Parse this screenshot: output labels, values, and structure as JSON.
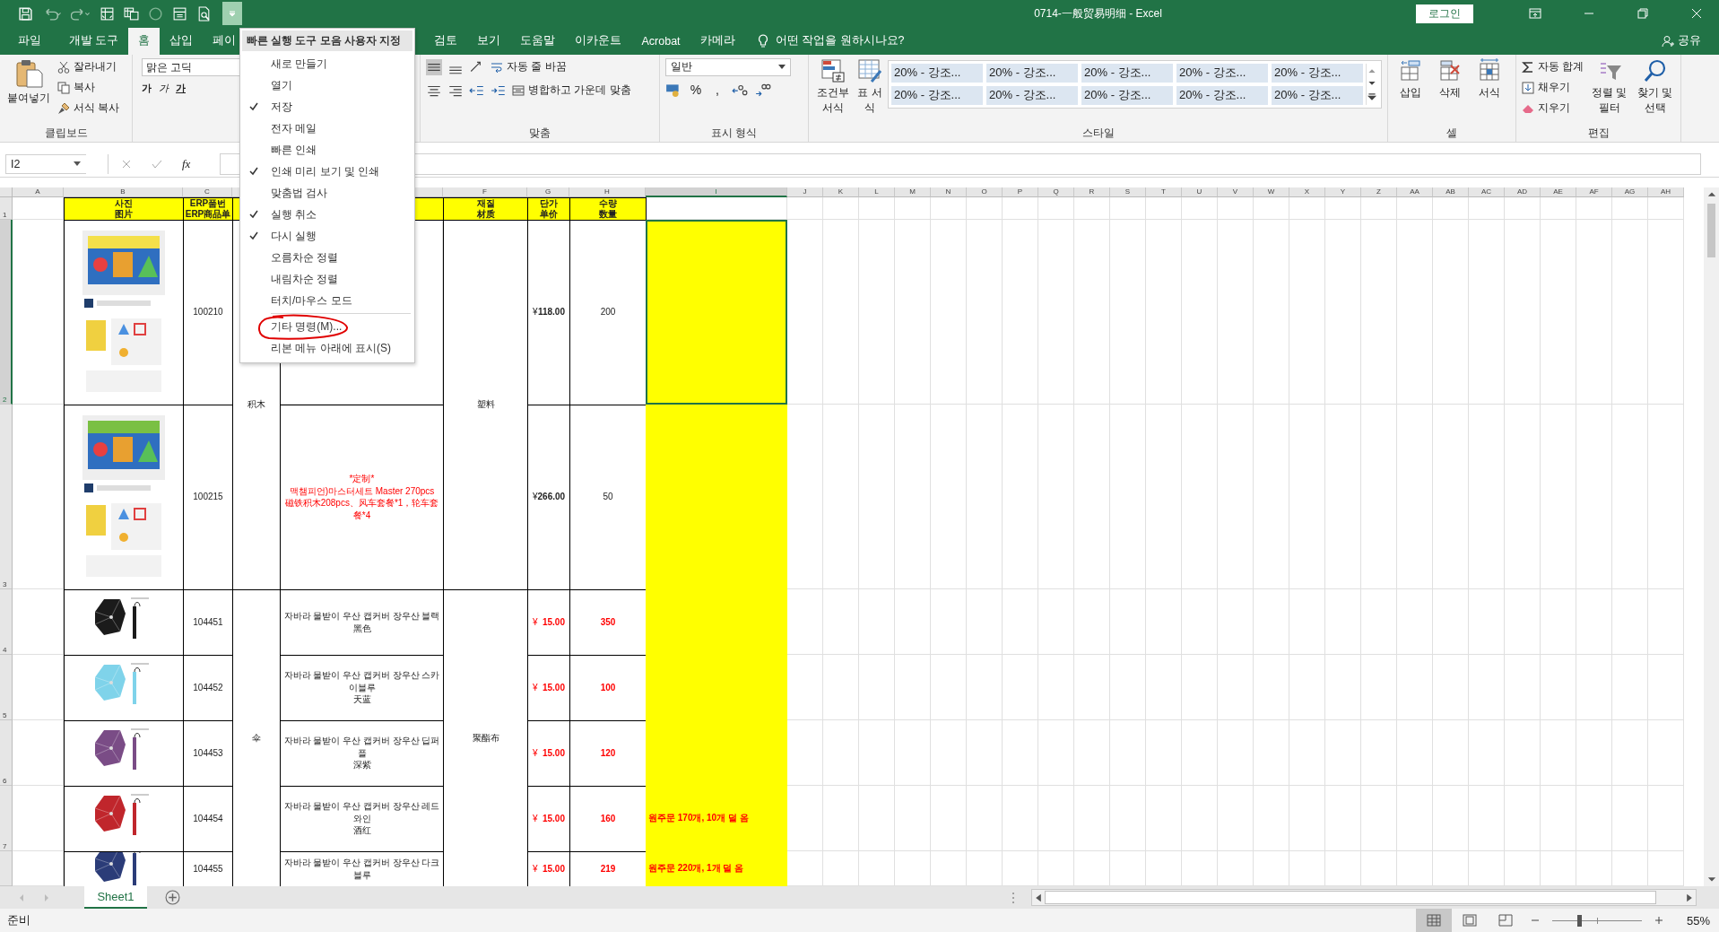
{
  "title_bar": {
    "file_title": "0714-一般贸易明细  -  Excel",
    "login": "로그인"
  },
  "tabs": [
    {
      "label": "파일",
      "selected": false
    },
    {
      "label": "개발 도구",
      "selected": false
    },
    {
      "label": "홈",
      "selected": true
    },
    {
      "label": "삽입",
      "selected": false
    },
    {
      "label": "페이",
      "selected": false
    },
    {
      "label": "검토",
      "selected": false
    },
    {
      "label": "보기",
      "selected": false
    },
    {
      "label": "도움말",
      "selected": false
    },
    {
      "label": "이카운트",
      "selected": false
    },
    {
      "label": "Acrobat",
      "selected": false
    },
    {
      "label": "카메라",
      "selected": false
    }
  ],
  "tell_me": "어떤 작업을 원하시나요?",
  "share": "공유",
  "ribbon": {
    "clipboard": {
      "label": "클립보드",
      "paste": "붙여넣기",
      "cut": "잘라내기",
      "copy": "복사",
      "format_painter": "서식 복사"
    },
    "font": {
      "font_name": "맑은 고딕",
      "buttons": [
        {
          "label": "가",
          "kind": "bold"
        },
        {
          "label": "가",
          "kind": "italic"
        },
        {
          "label": "가",
          "kind": "underline"
        }
      ]
    },
    "alignment": {
      "label": "맞춤",
      "wrap_text": "자동 줄 바꿈",
      "merge_center": "병합하고 가운데 맞춤"
    },
    "number": {
      "label": "표시 형식",
      "format": "일반",
      "percent": "%",
      "comma": ","
    },
    "styles": {
      "label": "스타일",
      "conditional": "조건부 서식",
      "table": "표 서식",
      "cell_styles": [
        "20% - 강조...",
        "20% - 강조...",
        "20% - 강조...",
        "20% - 강조...",
        "20% - 강조...",
        "20% - 강조...",
        "20% - 강조...",
        "20% - 강조...",
        "20% - 강조...",
        "20% - 강조..."
      ]
    },
    "cells": {
      "label": "셀",
      "buttons": [
        {
          "label": "삽입",
          "kind": "insert"
        },
        {
          "label": "삭제",
          "kind": "delete"
        },
        {
          "label": "서식",
          "kind": "format"
        }
      ]
    },
    "editing": {
      "label": "편집",
      "autosum": "자동 합계",
      "fill": "채우기",
      "clear": "지우기",
      "sort_filter": "정렬 및 필터",
      "find_select": "찾기 및 선택"
    }
  },
  "quick_access_menu": {
    "title": "빠른 실행 도구 모음 사용자 지정",
    "items": [
      {
        "label": "새로 만들기",
        "kind": "option",
        "checked": false,
        "circled": false
      },
      {
        "label": "열기",
        "kind": "option",
        "checked": false,
        "circled": false
      },
      {
        "label": "저장",
        "kind": "option",
        "checked": true,
        "circled": false
      },
      {
        "label": "전자 메일",
        "kind": "option",
        "checked": false,
        "circled": false
      },
      {
        "label": "빠른 인쇄",
        "kind": "option",
        "checked": false,
        "circled": false
      },
      {
        "label": "인쇄 미리 보기 및 인쇄",
        "kind": "option",
        "checked": true,
        "circled": false
      },
      {
        "label": "맞춤법 검사",
        "kind": "option",
        "checked": false,
        "circled": false
      },
      {
        "label": "실행 취소",
        "kind": "option",
        "checked": true,
        "circled": false
      },
      {
        "label": "다시 실행",
        "kind": "option",
        "checked": true,
        "circled": false
      },
      {
        "label": "오름차순 정렬",
        "kind": "option",
        "checked": false,
        "circled": false
      },
      {
        "label": "내림차순 정렬",
        "kind": "option",
        "checked": false,
        "circled": false
      },
      {
        "label": "터치/마우스 모드",
        "kind": "option",
        "checked": false,
        "circled": false
      },
      {
        "label": "기타 명령(M)...",
        "kind": "command",
        "circled": true
      },
      {
        "label": "리본 메뉴 아래에 표시(S)",
        "kind": "command",
        "circled": false
      }
    ]
  },
  "formula_bar": {
    "name_box": "I2",
    "function_label": "fx"
  },
  "sheet": {
    "columns": [
      {
        "label": "A",
        "selected": false
      },
      {
        "label": "B",
        "selected": false
      },
      {
        "label": "C",
        "selected": false
      },
      {
        "selected": false
      },
      {
        "selected": false
      },
      {
        "label": "F",
        "selected": false
      },
      {
        "label": "G",
        "selected": false
      },
      {
        "label": "H",
        "selected": false
      },
      {
        "label": "I",
        "selected": true
      },
      {
        "label": "J",
        "selected": false
      },
      {
        "label": "K",
        "selected": false
      },
      {
        "label": "L",
        "selected": false
      },
      {
        "label": "M",
        "selected": false
      },
      {
        "label": "N",
        "selected": false
      },
      {
        "label": "O",
        "selected": false
      },
      {
        "label": "P",
        "selected": false
      },
      {
        "label": "Q",
        "selected": false
      },
      {
        "label": "R",
        "selected": false
      },
      {
        "label": "S",
        "selected": false
      },
      {
        "label": "T",
        "selected": false
      },
      {
        "label": "U",
        "selected": false
      },
      {
        "label": "V",
        "selected": false
      },
      {
        "label": "W",
        "selected": false
      },
      {
        "label": "X",
        "selected": false
      },
      {
        "label": "Y",
        "selected": false
      },
      {
        "label": "Z",
        "selected": false
      },
      {
        "label": "AA",
        "selected": false
      },
      {
        "label": "AB",
        "selected": false
      },
      {
        "label": "AC",
        "selected": false
      },
      {
        "label": "AD",
        "selected": false
      },
      {
        "label": "AE",
        "selected": false
      },
      {
        "label": "AF",
        "selected": false
      },
      {
        "label": "AG",
        "selected": false
      },
      {
        "label": "AH",
        "selected": false
      }
    ],
    "rows": [
      {
        "number": "1",
        "selected": false,
        "cells": [
          null,
          {
            "kind": "header",
            "lines": [
              "사진",
              "图片"
            ]
          },
          {
            "kind": "header",
            "lines": [
              "ERP품번",
              "ERP商品单"
            ]
          },
          {
            "kind": "header"
          },
          {
            "kind": "header"
          },
          {
            "kind": "header",
            "lines": [
              "재질",
              "材质"
            ]
          },
          {
            "kind": "header",
            "lines": [
              "단가",
              "单价"
            ]
          },
          {
            "kind": "header",
            "lines": [
              "수량",
              "数量"
            ]
          },
          null
        ]
      },
      {
        "number": "2",
        "selected": true,
        "cells": [
          null,
          {
            "kind": "picture"
          },
          {
            "kind": "text",
            "lines": [
              "100210"
            ]
          },
          {
            "kind": "text",
            "lines": [
              "积木"
            ]
          },
          null,
          {
            "kind": "text",
            "lines": [
              "塑料"
            ]
          },
          {
            "kind": "price",
            "currency": "¥",
            "amount": "118.00"
          },
          {
            "kind": "text",
            "lines": [
              "200"
            ]
          },
          {
            "kind": "highlight",
            "selected": true
          }
        ]
      },
      {
        "number": "3",
        "selected": false,
        "cells": [
          null,
          {
            "kind": "picture"
          },
          {
            "kind": "text",
            "lines": [
              "100215"
            ]
          },
          {
            "kind": "merged_above"
          },
          {
            "kind": "text",
            "color": "#ff0000",
            "lines": [
              "*定制*",
              "맥챔피언)마스터세트 Master 270pcs",
              "磁铁积木208pcs、风车套餐*1，轮车套餐*4"
            ]
          },
          {
            "kind": "merged_above"
          },
          {
            "kind": "price",
            "currency": "¥",
            "amount": "266.00"
          },
          {
            "kind": "text",
            "lines": [
              "50"
            ]
          },
          {
            "kind": "highlight",
            "selected": false
          }
        ]
      },
      {
        "number": "4",
        "selected": false,
        "cells": [
          null,
          {
            "kind": "picture"
          },
          {
            "kind": "text",
            "lines": [
              "104451"
            ]
          },
          {
            "kind": "merged_below"
          },
          {
            "kind": "text",
            "lines": [
              "자바라 물받이 우산 캡커버 장우산 블랙",
              "黑色"
            ]
          },
          {
            "kind": "merged_below"
          },
          {
            "kind": "price",
            "currency": "¥",
            "amount": "15.00",
            "color": "#ff0000"
          },
          {
            "kind": "text",
            "lines": [
              "350"
            ],
            "color": "#ff0000",
            "bold": true
          },
          {
            "kind": "highlight",
            "selected": false
          }
        ]
      },
      {
        "number": "5",
        "selected": false,
        "cells": [
          null,
          {
            "kind": "picture"
          },
          {
            "kind": "text",
            "lines": [
              "104452"
            ]
          },
          {
            "kind": "merged_below"
          },
          {
            "kind": "text",
            "lines": [
              "자바라 물받이 우산 캡커버 장우산 스카이블루",
              "天蓝"
            ]
          },
          {
            "kind": "merged_below"
          },
          {
            "kind": "price",
            "currency": "¥",
            "amount": "15.00",
            "color": "#ff0000"
          },
          {
            "kind": "text",
            "lines": [
              "100"
            ],
            "color": "#ff0000",
            "bold": true
          },
          {
            "kind": "highlight",
            "selected": false
          }
        ]
      },
      {
        "number": "6",
        "selected": false,
        "cells": [
          null,
          {
            "kind": "picture"
          },
          {
            "kind": "text",
            "lines": [
              "104453"
            ]
          },
          {
            "kind": "text",
            "lines": [
              "伞"
            ]
          },
          {
            "kind": "text",
            "lines": [
              "자바라 물받이 우산 캡커버 장우산 딥퍼플",
              "深紫"
            ]
          },
          {
            "kind": "text",
            "lines": [
              "聚酯布"
            ]
          },
          {
            "kind": "price",
            "currency": "¥",
            "amount": "15.00",
            "color": "#ff0000"
          },
          {
            "kind": "text",
            "lines": [
              "120"
            ],
            "color": "#ff0000",
            "bold": true
          },
          {
            "kind": "highlight",
            "selected": false
          }
        ]
      },
      {
        "number": "7",
        "selected": false,
        "cells": [
          null,
          {
            "kind": "picture"
          },
          {
            "kind": "text",
            "lines": [
              "104454"
            ]
          },
          {
            "kind": "merged_above"
          },
          {
            "kind": "text",
            "lines": [
              "자바라 물받이 우산 캡커버 장우산 레드와인",
              "酒红"
            ]
          },
          {
            "kind": "merged_above"
          },
          {
            "kind": "price",
            "currency": "¥",
            "amount": "15.00",
            "color": "#ff0000"
          },
          {
            "kind": "text",
            "lines": [
              "160"
            ],
            "color": "#ff0000",
            "bold": true
          },
          {
            "kind": "highlight",
            "lines": [
              "원주문 170개, 10개 덜 옴"
            ],
            "color": "#ff0000",
            "selected": false
          }
        ]
      },
      {
        "selected": false,
        "cells": [
          null,
          {
            "kind": "picture"
          },
          {
            "kind": "text",
            "lines": [
              "104455"
            ]
          },
          {
            "kind": "merged_above"
          },
          {
            "kind": "text",
            "lines": [
              "자바라 물받이 우산 캡커버 장우산 다크블루"
            ]
          },
          {
            "kind": "merged_above"
          },
          {
            "kind": "price",
            "currency": "¥",
            "amount": "15.00",
            "color": "#ff0000"
          },
          {
            "kind": "text",
            "lines": [
              "219"
            ],
            "color": "#ff0000",
            "bold": true
          },
          {
            "kind": "highlight",
            "lines": [
              "원주문 220개, 1개 덜 옴"
            ],
            "color": "#ff0000",
            "selected": false
          }
        ]
      }
    ]
  },
  "sheet_tabs": [
    {
      "label": "Sheet1",
      "selected": true
    }
  ],
  "status_bar": {
    "status": "준비",
    "views": [
      {
        "selected": true
      },
      {
        "selected": false
      },
      {
        "selected": false
      }
    ],
    "zoom": {
      "level": 0.28
    },
    "zoom_label": "55%"
  }
}
